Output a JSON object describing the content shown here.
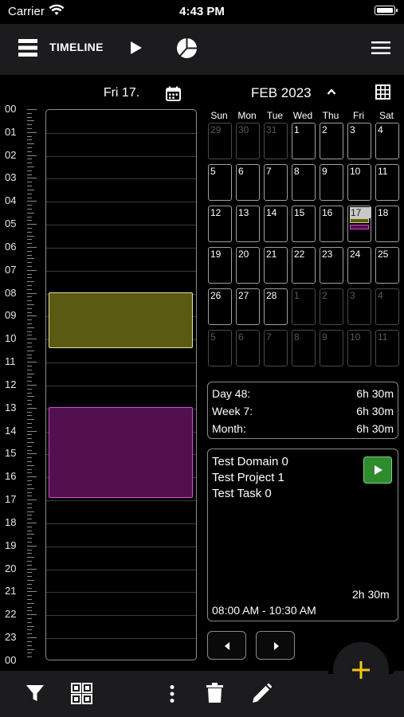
{
  "status_bar": {
    "carrier": "Carrier",
    "time": "4:43 PM"
  },
  "toolbar": {
    "title": "TIMELINE"
  },
  "day": {
    "label": "Fri 17."
  },
  "month": {
    "label": "FEB 2023"
  },
  "hours": [
    "00",
    "01",
    "02",
    "03",
    "04",
    "05",
    "06",
    "07",
    "08",
    "09",
    "10",
    "11",
    "12",
    "13",
    "14",
    "15",
    "16",
    "17",
    "18",
    "19",
    "20",
    "21",
    "22",
    "23",
    "00"
  ],
  "calendar": {
    "weekdays": [
      "Sun",
      "Mon",
      "Tue",
      "Wed",
      "Thu",
      "Fri",
      "Sat"
    ],
    "weeks": [
      [
        {
          "d": "29",
          "o": true
        },
        {
          "d": "30",
          "o": true
        },
        {
          "d": "31",
          "o": true
        },
        {
          "d": "1"
        },
        {
          "d": "2"
        },
        {
          "d": "3"
        },
        {
          "d": "4"
        }
      ],
      [
        {
          "d": "5"
        },
        {
          "d": "6"
        },
        {
          "d": "7"
        },
        {
          "d": "8"
        },
        {
          "d": "9"
        },
        {
          "d": "10"
        },
        {
          "d": "11"
        }
      ],
      [
        {
          "d": "12"
        },
        {
          "d": "13"
        },
        {
          "d": "14"
        },
        {
          "d": "15"
        },
        {
          "d": "16"
        },
        {
          "d": "17",
          "today": true
        },
        {
          "d": "18"
        }
      ],
      [
        {
          "d": "19"
        },
        {
          "d": "20"
        },
        {
          "d": "21"
        },
        {
          "d": "22"
        },
        {
          "d": "23"
        },
        {
          "d": "24"
        },
        {
          "d": "25"
        }
      ],
      [
        {
          "d": "26"
        },
        {
          "d": "27"
        },
        {
          "d": "28"
        },
        {
          "d": "1",
          "o": true
        },
        {
          "d": "2",
          "o": true
        },
        {
          "d": "3",
          "o": true
        },
        {
          "d": "4",
          "o": true
        }
      ],
      [
        {
          "d": "5",
          "o": true
        },
        {
          "d": "6",
          "o": true
        },
        {
          "d": "7",
          "o": true
        },
        {
          "d": "8",
          "o": true
        },
        {
          "d": "9",
          "o": true
        },
        {
          "d": "10",
          "o": true
        },
        {
          "d": "11",
          "o": true
        }
      ]
    ]
  },
  "summary": {
    "day_label": "Day 48:",
    "day_value": "6h 30m",
    "week_label": "Week 7:",
    "week_value": "6h 30m",
    "month_label": "Month:",
    "month_value": "6h 30m"
  },
  "detail": {
    "domain": "Test Domain 0",
    "project": "Test Project 1",
    "task": "Test Task 0",
    "duration": "2h 30m",
    "time_range": "08:00 AM - 10:30 AM"
  },
  "colors": {
    "entry_yellow": "#5a5a12",
    "entry_purple": "#52104f",
    "accent_fab": "#f5c518",
    "play_green": "#2e8b2e"
  },
  "icons": [
    "wifi-icon",
    "battery-icon",
    "list-view-icon",
    "play-icon",
    "pie-chart-icon",
    "menu-icon",
    "calendar-icon",
    "chevron-up-icon",
    "grid-icon",
    "play-icon",
    "chevron-left-icon",
    "chevron-right-icon",
    "filter-icon",
    "apps-icon",
    "more-vertical-icon",
    "trash-icon",
    "pencil-icon",
    "plus-icon"
  ]
}
